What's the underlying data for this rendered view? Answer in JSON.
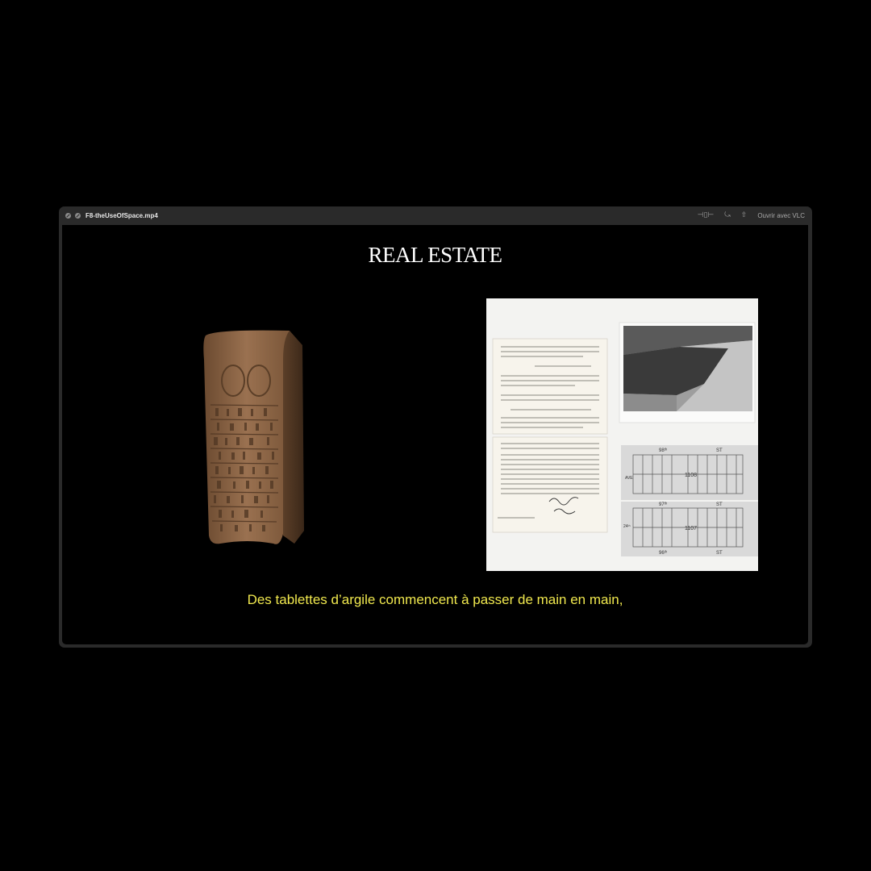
{
  "player": {
    "filename": "F8-theUseOfSpace.mp4",
    "open_with": "Ouvrir avec VLC"
  },
  "video": {
    "title": "REAL ESTATE",
    "subtitle": "Des tablettes d’argile commencent à passer de main en main,"
  },
  "images": {
    "plan_labels": [
      "98ᵗʰ",
      "ST",
      "1108",
      "AVE",
      "97ᵗʰ",
      "ST",
      "1107",
      "24ᵗʰ",
      "96ᵗʰ",
      "ST"
    ]
  },
  "colors": {
    "background": "#000000",
    "window_chrome": "#2a2a2a",
    "subtitle": "#f0e84e"
  }
}
